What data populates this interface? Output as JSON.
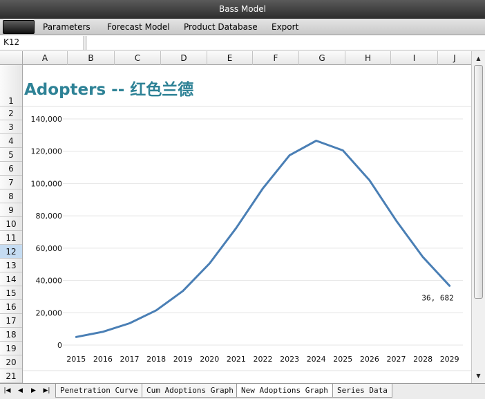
{
  "window": {
    "title": "Bass Model"
  },
  "ribbon": {
    "menu": [
      "Parameters",
      "Forecast Model",
      "Product Database",
      "Export"
    ]
  },
  "name_box": {
    "cell": "K12"
  },
  "columns": [
    "A",
    "B",
    "C",
    "D",
    "E",
    "F",
    "G",
    "H",
    "I",
    "J"
  ],
  "rows": [
    "1",
    "2",
    "3",
    "4",
    "5",
    "6",
    "7",
    "8",
    "9",
    "10",
    "11",
    "12",
    "13",
    "14",
    "15",
    "16",
    "17",
    "18",
    "19",
    "20",
    "21"
  ],
  "selected_row": "12",
  "sheet_tabs": [
    "Penetration Curve",
    "Cum Adoptions Graph",
    "New Adoptions Graph",
    "Series Data"
  ],
  "active_tab": "New Adoptions Graph",
  "chart_data": {
    "type": "line",
    "title": "Adopters -- 红色兰德",
    "xlabel": "",
    "ylabel": "",
    "x": [
      "2015",
      "2016",
      "2017",
      "2018",
      "2019",
      "2020",
      "2021",
      "2022",
      "2023",
      "2024",
      "2025",
      "2026",
      "2027",
      "2028",
      "2029"
    ],
    "series": [
      {
        "values": [
          5000,
          8200,
          13500,
          21500,
          33500,
          50500,
          72500,
          97000,
          117500,
          126500,
          120500,
          102000,
          77000,
          54500,
          36682
        ]
      }
    ],
    "ylim": [
      0,
      140000
    ],
    "yticks": [
      "0",
      "20,000",
      "40,000",
      "60,000",
      "80,000",
      "100,000",
      "120,000",
      "140,000"
    ],
    "grid": true,
    "line_color": "#4a7fb5",
    "annotation": "36, 682"
  }
}
